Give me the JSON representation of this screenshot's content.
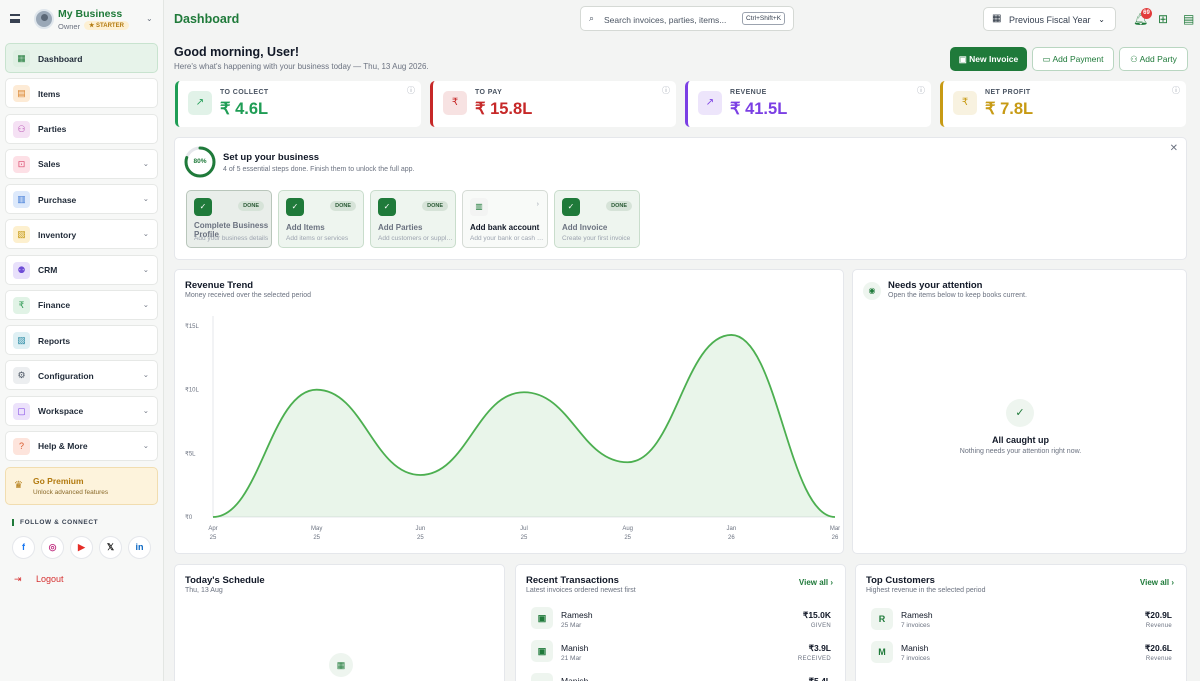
{
  "sidebar": {
    "business_name": "My Business",
    "role": "Owner",
    "plan_badge": "★ STARTER",
    "items": [
      {
        "label": "Dashboard",
        "icon": "dashboard-icon",
        "has_children": false,
        "active": true
      },
      {
        "label": "Items",
        "icon": "items-icon",
        "has_children": false
      },
      {
        "label": "Parties",
        "icon": "parties-icon",
        "has_children": false
      },
      {
        "label": "Sales",
        "icon": "sales-icon",
        "has_children": true
      },
      {
        "label": "Purchase",
        "icon": "purchase-icon",
        "has_children": true
      },
      {
        "label": "Inventory",
        "icon": "inventory-icon",
        "has_children": true
      },
      {
        "label": "CRM",
        "icon": "crm-icon",
        "has_children": true
      },
      {
        "label": "Finance",
        "icon": "finance-icon",
        "has_children": true
      },
      {
        "label": "Reports",
        "icon": "reports-icon",
        "has_children": false
      },
      {
        "label": "Configuration",
        "icon": "gear-icon",
        "has_children": true
      },
      {
        "label": "Workspace",
        "icon": "workspace-icon",
        "has_children": true
      },
      {
        "label": "Help & More",
        "icon": "help-icon",
        "has_children": true
      }
    ],
    "premium": {
      "title": "Go Premium",
      "subtitle": "Unlock advanced features"
    },
    "follow_label": "FOLLOW & CONNECT",
    "socials": [
      "facebook-icon",
      "instagram-icon",
      "youtube-icon",
      "x-icon",
      "linkedin-icon"
    ],
    "logout_label": "Logout"
  },
  "header": {
    "title": "Dashboard",
    "search_placeholder": "Search invoices, parties, items...",
    "search_shortcut": "Ctrl+Shift+K",
    "fiscal_year": "Previous Fiscal Year",
    "notification_count": "69"
  },
  "greeting": {
    "title": "Good morning, User!",
    "subtitle": "Here's what's happening with your business today — Thu, 13 Aug 2026."
  },
  "actions": {
    "new_invoice": "New Invoice",
    "add_payment": "Add Payment",
    "add_party": "Add Party"
  },
  "kpis": [
    {
      "label": "TO COLLECT",
      "value": "₹ 4.6L",
      "color": "#1f9d55",
      "icon": "trend-up-icon"
    },
    {
      "label": "TO PAY",
      "value": "₹ 15.8L",
      "color": "#c62828",
      "icon": "rupee-icon"
    },
    {
      "label": "REVENUE",
      "value": "₹ 41.5L",
      "color": "#7b3fe4",
      "icon": "trend-up-icon"
    },
    {
      "label": "NET PROFIT",
      "value": "₹ 7.8L",
      "color": "#c79a14",
      "icon": "rupee-icon"
    }
  ],
  "setup": {
    "percent_text": "80%",
    "progress": 0.8,
    "title": "Set up your business",
    "subtitle": "4 of 5 essential steps done. Finish them to unlock the full app.",
    "steps": [
      {
        "title": "Complete Business Profile",
        "subtitle": "Add your business details",
        "done": true,
        "badge": "DONE"
      },
      {
        "title": "Add Items",
        "subtitle": "Add items or services",
        "done": true,
        "badge": "DONE"
      },
      {
        "title": "Add Parties",
        "subtitle": "Add customers or suppliers",
        "done": true,
        "badge": "DONE"
      },
      {
        "title": "Add bank account",
        "subtitle": "Add your bank or cash account",
        "done": false,
        "badge": ""
      },
      {
        "title": "Add Invoice",
        "subtitle": "Create your first invoice",
        "done": true,
        "badge": "DONE"
      }
    ]
  },
  "revenue_trend": {
    "title": "Revenue Trend",
    "subtitle": "Money received over the selected period"
  },
  "chart_data": {
    "type": "area",
    "title": "Revenue Trend",
    "x": [
      "Apr 25",
      "May 25",
      "Jun 25",
      "Jul 25",
      "Aug 25",
      "Jan 26",
      "Mar 26"
    ],
    "x_ticks": [
      [
        "Apr",
        "25"
      ],
      [
        "May",
        "25"
      ],
      [
        "Jun",
        "25"
      ],
      [
        "Jul",
        "25"
      ],
      [
        "Aug",
        "25"
      ],
      [
        "Jan",
        "26"
      ],
      [
        "Mar",
        "26"
      ]
    ],
    "y_ticks": [
      "₹0",
      "₹5L",
      "₹10L",
      "₹15L"
    ],
    "ylim": [
      0,
      15
    ],
    "series": [
      {
        "values": [
          0,
          10,
          3.3,
          9.8,
          4.3,
          14.3,
          0
        ]
      }
    ],
    "grid": false,
    "color": "#4caf50"
  },
  "attention": {
    "title": "Needs your attention",
    "subtitle": "Open the items below to keep books current.",
    "empty_title": "All caught up",
    "empty_subtitle": "Nothing needs your attention right now."
  },
  "schedule": {
    "title": "Today's Schedule",
    "date": "Thu, 13 Aug"
  },
  "transactions": {
    "title": "Recent Transactions",
    "subtitle": "Latest invoices ordered newest first",
    "view_all": "View all ›",
    "rows": [
      {
        "name": "Ramesh",
        "date": "25 Mar",
        "amount": "₹15.0K",
        "tag": "GIVEN"
      },
      {
        "name": "Manish",
        "date": "21 Mar",
        "amount": "₹3.9L",
        "tag": "RECEIVED"
      },
      {
        "name": "Manish",
        "date": "",
        "amount": "₹5.4L",
        "tag": ""
      }
    ]
  },
  "top_customers": {
    "title": "Top Customers",
    "subtitle": "Highest revenue in the selected period",
    "view_all": "View all ›",
    "rows": [
      {
        "initial": "R",
        "name": "Ramesh",
        "invoices": "7 invoices",
        "amount": "₹20.9L",
        "tag": "Revenue"
      },
      {
        "initial": "M",
        "name": "Manish",
        "invoices": "7 invoices",
        "amount": "₹20.6L",
        "tag": "Revenue"
      }
    ]
  }
}
